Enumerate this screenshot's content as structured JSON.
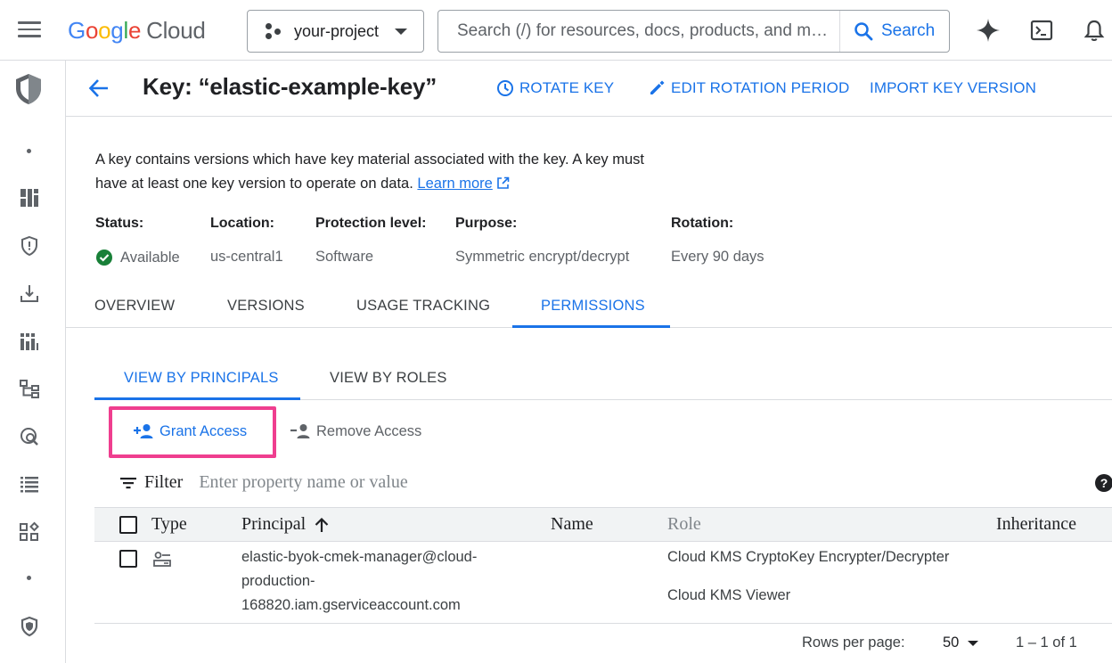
{
  "topbar": {
    "logo_google": "Google",
    "logo_cloud": "Cloud",
    "project_name": "your-project",
    "search_placeholder": "Search (/) for resources, docs, products, and m…",
    "search_button": "Search"
  },
  "header": {
    "title": "Key: “elastic-example-key”",
    "actions": {
      "rotate": "ROTATE KEY",
      "edit_rotation": "EDIT ROTATION PERIOD",
      "import_version": "IMPORT KEY VERSION"
    }
  },
  "description": {
    "line1": "A key contains versions which have key material associated with the key. A key must",
    "line2": "have at least one key version to operate on data.",
    "learn_more": "Learn more"
  },
  "meta": {
    "status": {
      "label": "Status:",
      "value": "Available"
    },
    "location": {
      "label": "Location:",
      "value": "us-central1"
    },
    "protection": {
      "label": "Protection level:",
      "value": "Software"
    },
    "purpose": {
      "label": "Purpose:",
      "value": "Symmetric encrypt/decrypt"
    },
    "rotation": {
      "label": "Rotation:",
      "value": "Every 90 days"
    }
  },
  "tabs": [
    "OVERVIEW",
    "VERSIONS",
    "USAGE TRACKING",
    "PERMISSIONS"
  ],
  "subtabs": [
    "VIEW BY PRINCIPALS",
    "VIEW BY ROLES"
  ],
  "buttons": {
    "grant": "Grant Access",
    "remove": "Remove Access"
  },
  "filter": {
    "label": "Filter",
    "placeholder": "Enter property name or value"
  },
  "table": {
    "headers": {
      "type": "Type",
      "principal": "Principal",
      "name": "Name",
      "role": "Role",
      "inheritance": "Inheritance"
    },
    "rows": [
      {
        "principal_lines": [
          "elastic-byok-cmek-manager@cloud-",
          "production-",
          "168820.iam.gserviceaccount.com"
        ],
        "name": "",
        "roles": [
          "Cloud KMS CryptoKey Encrypter/Decrypter",
          "Cloud KMS Viewer"
        ],
        "inheritance": ""
      }
    ]
  },
  "pagination": {
    "rows_per_page_label": "Rows per page:",
    "rows_per_page": "50",
    "range": "1 – 1 of 1"
  },
  "colors": {
    "accent": "#1a73e8",
    "highlight": "#ef3e8f",
    "success": "#188038"
  }
}
